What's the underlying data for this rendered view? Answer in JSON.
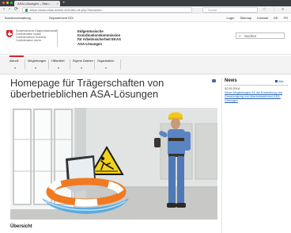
{
  "browser": {
    "tab_title": "ASA-Lösungen – Stan…",
    "tab_close": "×",
    "new_tab": "+",
    "url": "https://www.ekas.admin.ch/index-de.php?frameset=",
    "search_placeholder": "Suche",
    "nav_back": "‹",
    "nav_forward": "›",
    "nav_reload": "⟳",
    "browser_icons": "☆ ⋮ ≡"
  },
  "federal_bar": {
    "left_item": "Bundesverwaltung",
    "middle_item": "Departement EDI",
    "links": [
      "Login",
      "Sitemap",
      "Kontakt",
      "DE",
      "FR"
    ]
  },
  "header": {
    "confederation_lines": [
      "Schweizerische Eidgenossenschaft",
      "Confédération suisse",
      "Confederazione Svizzera",
      "Confederaziun svizra"
    ],
    "department_lines": [
      "Eidgenössische",
      "Koordinationskommission",
      "für Arbeitssicherheit EKAS",
      "ASA-Lösungen"
    ],
    "search_label": "Suchen",
    "search_icon": "search-icon"
  },
  "main_nav": {
    "items": [
      {
        "label": "Aktuell",
        "caret": "▾"
      },
      {
        "label": "Wegleitungen",
        "caret": "▾"
      },
      {
        "label": "Hilfsmittel",
        "caret": "▾"
      },
      {
        "label": "Eigene Dateien",
        "caret": "▾"
      },
      {
        "label": "Organisation",
        "caret": "▾"
      }
    ]
  },
  "content": {
    "title": "Homepage für Trägerschaften von überbetrieblichen ASA-Lösungen",
    "section_heading": "Übersicht"
  },
  "news": {
    "title": "News",
    "all_link": "Alle",
    "date": "02.05.2018",
    "link_text": "Neue Wegleitungen für die Erarbeitung und Genehmigung von überbetrieblichen ASA-Lösungen"
  },
  "colors": {
    "brand_red": "#d8232a",
    "link_blue": "#1f5fb8"
  }
}
